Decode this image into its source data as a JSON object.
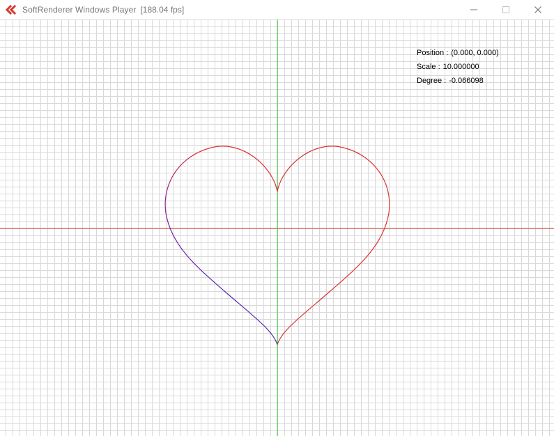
{
  "window": {
    "title": "SoftRenderer Windows Player",
    "fps": "[188.04 fps]"
  },
  "icons": {
    "app": "softrenderer-logo-icon",
    "minimize": "minimize-icon",
    "maximize": "maximize-icon",
    "close": "close-icon"
  },
  "colors": {
    "x_axis": "#d33b32",
    "y_axis": "#34c134",
    "grid": "#d9d9d9",
    "heart_red": "#d93434",
    "heart_purple": "#8b1fa6",
    "heart_blue": "#1f3db3",
    "heart_teal": "#2b7d72",
    "heart_green": "#20b21f"
  },
  "overlay": {
    "position_label": "Position :",
    "position_value": "(0.000, 0.000)",
    "scale_label": "Scale :",
    "scale_value": "10.000000",
    "degree_label": "Degree :",
    "degree_value": "-0.066098"
  }
}
